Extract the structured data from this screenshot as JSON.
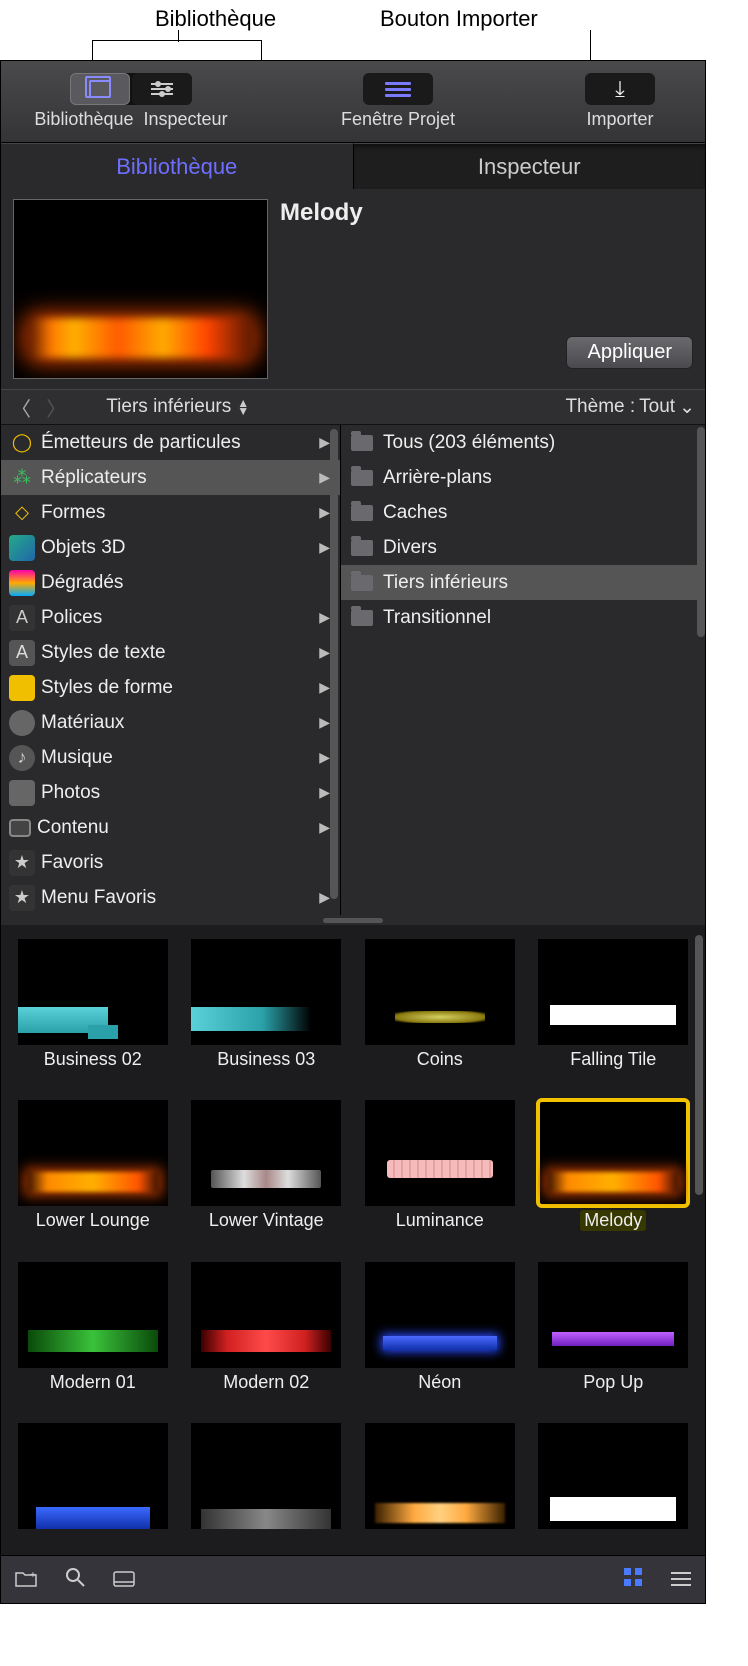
{
  "callouts": {
    "library": "Bibliothèque",
    "import": "Bouton Importer"
  },
  "toolbar": {
    "library": "Bibliothèque",
    "inspector": "Inspecteur",
    "project": "Fenêtre Projet",
    "import": "Importer"
  },
  "panel_tabs": {
    "library": "Bibliothèque",
    "inspector": "Inspecteur"
  },
  "preview": {
    "title": "Melody",
    "apply": "Appliquer"
  },
  "nav": {
    "crumb": "Tiers inférieurs",
    "theme_label": "Thème :",
    "theme_value": "Tout"
  },
  "categories": [
    {
      "label": "Émetteurs de particules",
      "icon": "ci-emit",
      "glyph": "◯",
      "chev": true
    },
    {
      "label": "Réplicateurs",
      "icon": "ci-rep",
      "glyph": "⁂",
      "chev": true,
      "selected": true
    },
    {
      "label": "Formes",
      "icon": "ci-shape",
      "glyph": "◇",
      "chev": true
    },
    {
      "label": "Objets 3D",
      "icon": "ci-3d",
      "glyph": "",
      "chev": true
    },
    {
      "label": "Dégradés",
      "icon": "ci-grad",
      "glyph": "",
      "chev": false
    },
    {
      "label": "Polices",
      "icon": "ci-font",
      "glyph": "A",
      "chev": true
    },
    {
      "label": "Styles de texte",
      "icon": "ci-tstyle",
      "glyph": "A",
      "chev": true
    },
    {
      "label": "Styles de forme",
      "icon": "ci-sstyle",
      "glyph": "",
      "chev": true
    },
    {
      "label": "Matériaux",
      "icon": "ci-mat",
      "glyph": "",
      "chev": true
    },
    {
      "label": "Musique",
      "icon": "ci-music",
      "glyph": "♪",
      "chev": true
    },
    {
      "label": "Photos",
      "icon": "ci-photo",
      "glyph": "",
      "chev": true
    },
    {
      "label": "Contenu",
      "icon": "ci-content",
      "glyph": "",
      "chev": true
    },
    {
      "label": "Favoris",
      "icon": "ci-fav",
      "glyph": "★",
      "chev": false
    },
    {
      "label": "Menu Favoris",
      "icon": "ci-favmenu",
      "glyph": "★",
      "chev": true
    }
  ],
  "folders": [
    {
      "label": "Tous (203 éléments)"
    },
    {
      "label": "Arrière-plans"
    },
    {
      "label": "Caches"
    },
    {
      "label": "Divers"
    },
    {
      "label": "Tiers inférieurs",
      "selected": true
    },
    {
      "label": "Transitionnel"
    }
  ],
  "items": [
    {
      "label": "Business 02",
      "strips": [
        "s-teal",
        "s-small-teal"
      ]
    },
    {
      "label": "Business 03",
      "strips": [
        "s-teal2"
      ]
    },
    {
      "label": "Coins",
      "strips": [
        "s-yellow"
      ]
    },
    {
      "label": "Falling Tile",
      "strips": [
        "s-white"
      ]
    },
    {
      "label": "Lower Lounge",
      "strips": [
        "s-orange"
      ]
    },
    {
      "label": "Lower Vintage",
      "strips": [
        "s-vintage"
      ]
    },
    {
      "label": "Luminance",
      "strips": [
        "s-pink"
      ]
    },
    {
      "label": "Melody",
      "strips": [
        "s-orange"
      ],
      "selected": true
    },
    {
      "label": "Modern 01",
      "strips": [
        "s-green"
      ]
    },
    {
      "label": "Modern 02",
      "strips": [
        "s-red"
      ]
    },
    {
      "label": "Néon",
      "strips": [
        "s-neon"
      ]
    },
    {
      "label": "Pop Up",
      "strips": [
        "s-purple"
      ]
    },
    {
      "label": "",
      "strips": [
        "s-blue"
      ]
    },
    {
      "label": "",
      "strips": [
        "s-grey"
      ]
    },
    {
      "label": "",
      "strips": [
        "s-amber"
      ]
    },
    {
      "label": "",
      "strips": [
        "s-white2"
      ]
    }
  ]
}
